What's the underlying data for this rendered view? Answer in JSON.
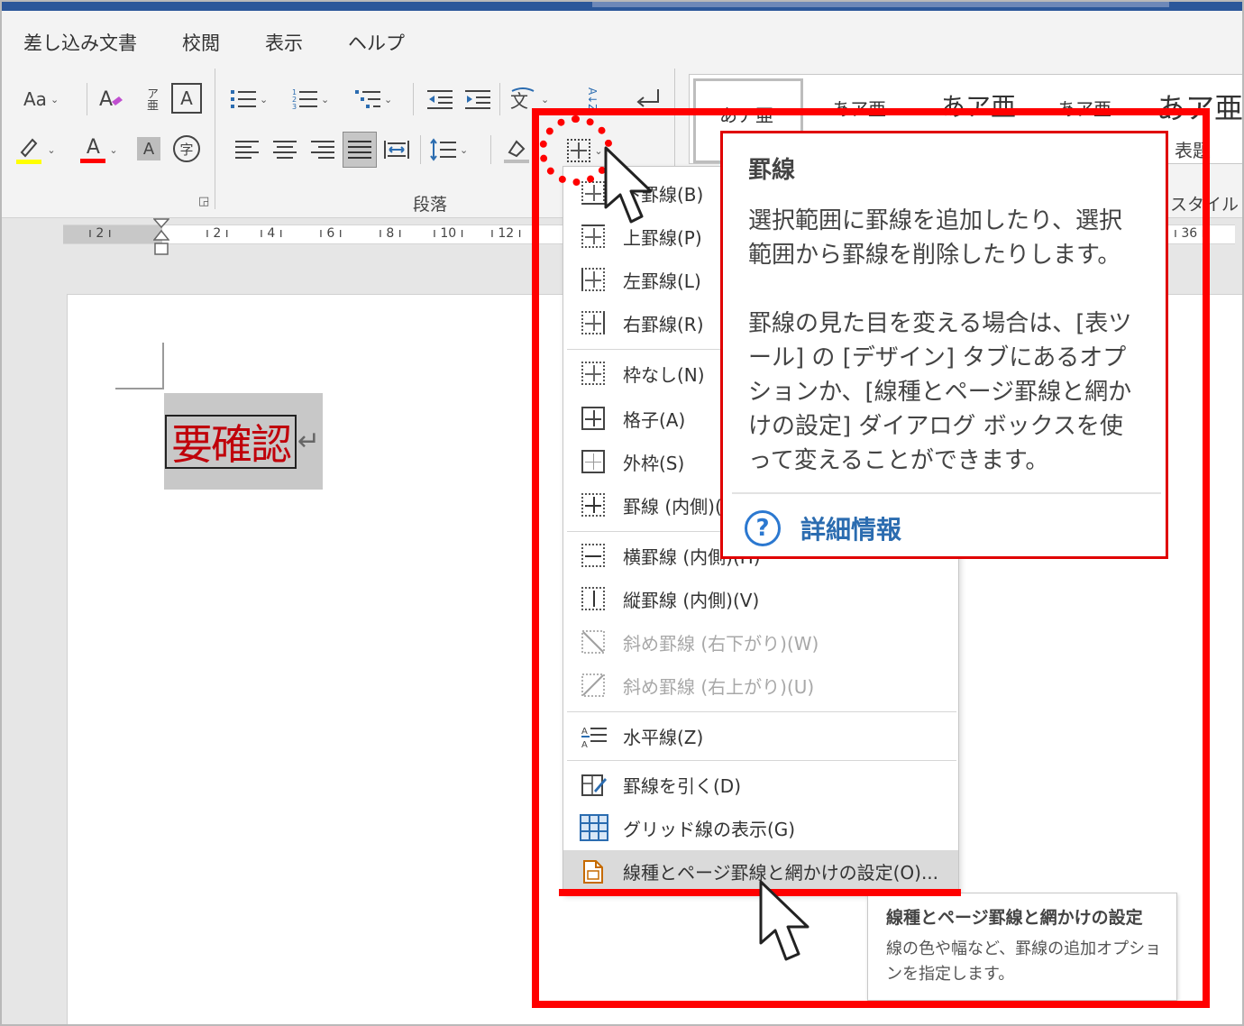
{
  "menu": {
    "tabs": [
      "差し込み文書",
      "校閲",
      "表示",
      "ヘルプ"
    ]
  },
  "ribbon": {
    "font": {
      "change_case": "Aa",
      "phonetic_guide": "ア亜",
      "char_border": "A",
      "font_color": "A",
      "char_shading": "A",
      "enclose_char": "字"
    },
    "paragraph": {
      "group_label": "段落",
      "sort": "A↓Z"
    },
    "styles": {
      "group_label": "スタイル",
      "items": [
        "あア亜",
        "あア亜",
        "あア亜",
        "あア亜",
        "あア亜"
      ],
      "heading_caption": "表題"
    }
  },
  "ruler": {
    "labels": [
      "2",
      "2",
      "4",
      "6",
      "8",
      "10",
      "12",
      "36"
    ]
  },
  "document": {
    "cell_text": "要確認",
    "paragraph_mark": "↵"
  },
  "border_menu": {
    "items": [
      {
        "label": "下罫線(B)",
        "disabled": false
      },
      {
        "label": "上罫線(P)",
        "disabled": false
      },
      {
        "label": "左罫線(L)",
        "disabled": false
      },
      {
        "label": "右罫線(R)",
        "disabled": false
      },
      {
        "label": "枠なし(N)",
        "disabled": false
      },
      {
        "label": "格子(A)",
        "disabled": false
      },
      {
        "label": "外枠(S)",
        "disabled": false
      },
      {
        "label": "罫線 (内側)(I)",
        "disabled": false
      },
      {
        "label": "横罫線 (内側)(H)",
        "disabled": false
      },
      {
        "label": "縦罫線 (内側)(V)",
        "disabled": false
      },
      {
        "label": "斜め罫線 (右下がり)(W)",
        "disabled": true
      },
      {
        "label": "斜め罫線 (右上がり)(U)",
        "disabled": true
      },
      {
        "label": "水平線(Z)",
        "disabled": false
      },
      {
        "label": "罫線を引く(D)",
        "disabled": false
      },
      {
        "label": "グリッド線の表示(G)",
        "disabled": false
      },
      {
        "label": "線種とページ罫線と網かけの設定(O)...",
        "disabled": false,
        "selected": true
      }
    ]
  },
  "tooltip": {
    "title": "罫線",
    "body1": "選択範囲に罫線を追加したり、選択範囲から罫線を削除したりします。",
    "body2": "罫線の見た目を変える場合は、[表ツール] の [デザイン] タブにあるオプションか、[線種とページ罫線と網かけの設定] ダイアログ ボックスを使って変えることができます。",
    "help_label": "詳細情報",
    "help_icon": "?"
  },
  "tooltip2": {
    "title": "線種とページ罫線と網かけの設定",
    "body": "線の色や幅など、罫線の追加オプションを指定します。"
  },
  "colors": {
    "highlight_red": "#ff0000",
    "cell_text": "#c0000a",
    "title_bar": "#2b579a",
    "help_blue": "#2b6cb0"
  }
}
